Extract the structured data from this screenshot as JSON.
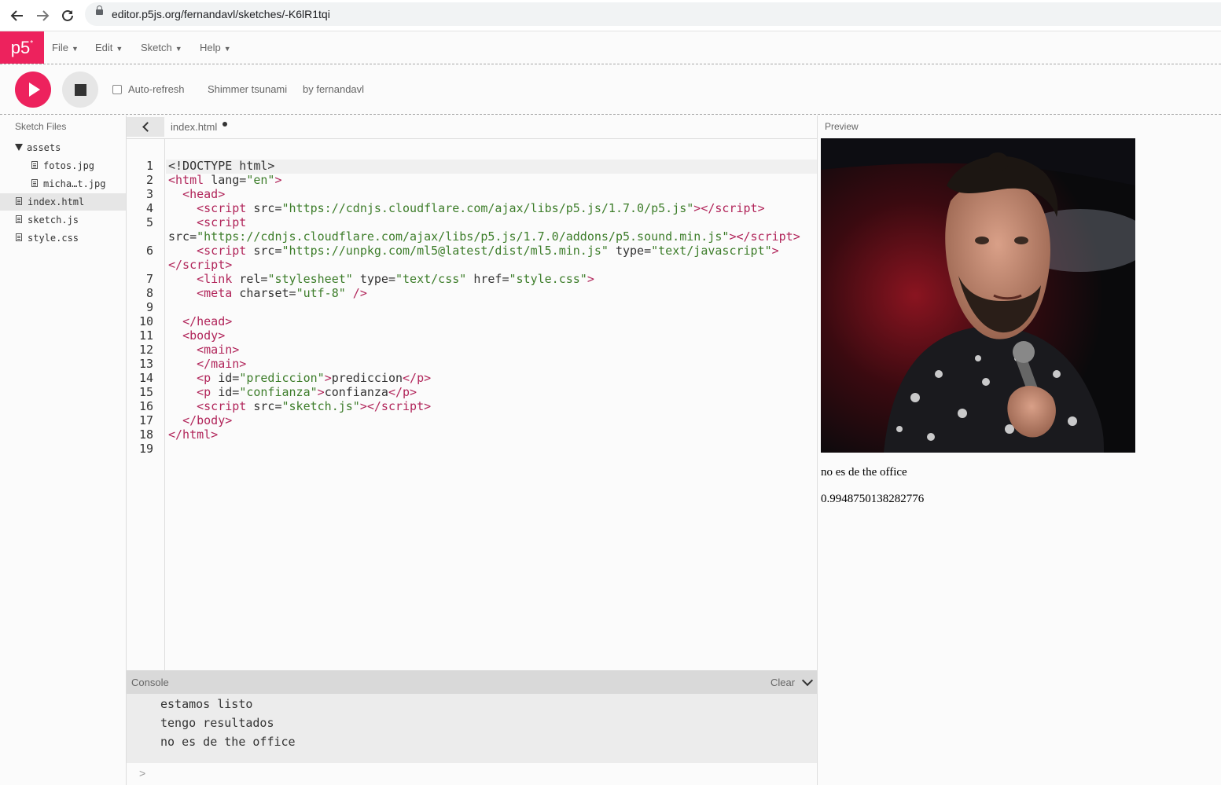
{
  "browser": {
    "url": "editor.p5js.org/fernandavl/sketches/-K6lR1tqi",
    "back_icon": "arrow-left-icon",
    "forward_icon": "arrow-right-icon",
    "reload_icon": "reload-icon"
  },
  "menubar": {
    "logo": "p5",
    "logo_sup": "*",
    "items": [
      "File",
      "Edit",
      "Sketch",
      "Help"
    ]
  },
  "toolbar": {
    "auto_refresh_label": "Auto-refresh",
    "auto_refresh_checked": false,
    "sketch_name": "Shimmer tsunami",
    "owner": "by fernandavl"
  },
  "sidebar": {
    "title": "Sketch Files",
    "folder": "assets",
    "files": [
      "fotos.jpg",
      "micha…t.jpg",
      "index.html",
      "sketch.js",
      "style.css"
    ],
    "selected": "index.html"
  },
  "editor": {
    "tab_name": "index.html",
    "line_numbers": [
      "1",
      "2",
      "3",
      "4",
      "5",
      "",
      "6",
      "",
      "7",
      "8",
      "9",
      "10",
      "11",
      "12",
      "13",
      "14",
      "15",
      "16",
      "17",
      "18",
      "19"
    ]
  },
  "console": {
    "title": "Console",
    "clear_label": "Clear",
    "messages": [
      "estamos listo",
      "tengo resultados",
      "no es de the office"
    ],
    "prompt": ">"
  },
  "preview": {
    "title": "Preview",
    "prediction": "no es de the office",
    "confidence": "0.9948750138282776"
  },
  "colors": {
    "brand": "#ed225d",
    "tag": "#b1255a",
    "string": "#3d7d2a"
  }
}
